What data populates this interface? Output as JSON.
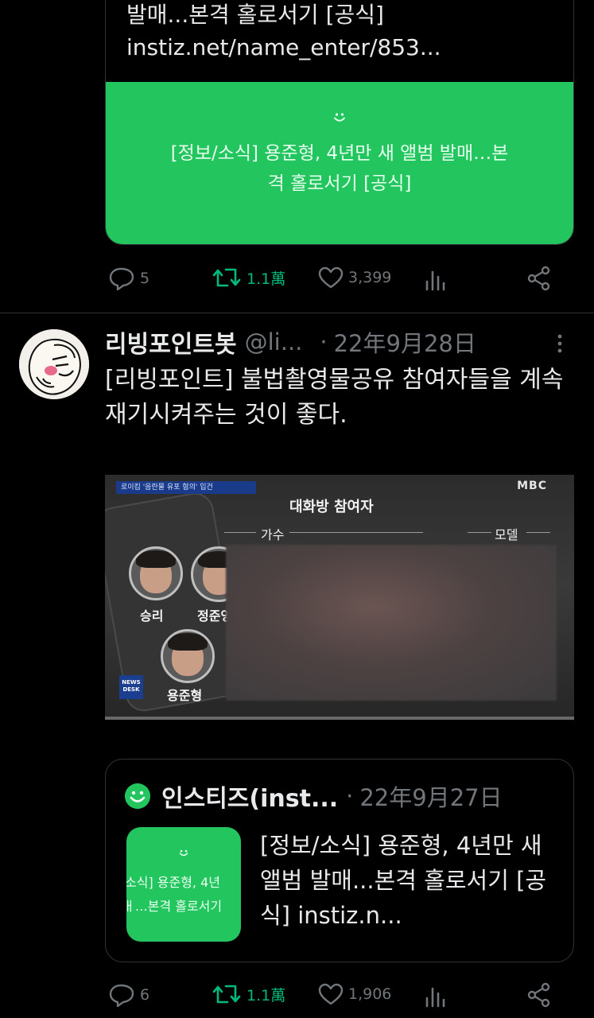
{
  "tweet1": {
    "card_title_line1": "발매...본격 홀로서기 [공식]",
    "card_url": "instiz.net/name_enter/853...",
    "card_image_text": "[정보/소식] 용준형, 4년만 새 앨범 발매…본격 홀로서기 [공식]",
    "replies": "5",
    "retweets": "1.1萬",
    "likes": "3,399"
  },
  "tweet2": {
    "display_name": "리빙포인트봇",
    "handle": "@li...",
    "dot": "·",
    "date": "22年9月28日",
    "text": "[리빙포인트] 불법촬영물공유 참여자들을 계속 재기시켜주는 것이 좋다.",
    "media": {
      "top_caption": "로이킴 '음란물 유포 혐의' 입건",
      "network": "MBC",
      "title": "대화방 참여자",
      "label_singer": "가수",
      "label_model": "모델",
      "names": [
        "승리",
        "정준영",
        "용준형"
      ],
      "news_badge": "NEWS DESK"
    },
    "quote": {
      "name": "인스티즈(inst...",
      "dot": "·",
      "date": "22年9月27日",
      "thumb_line1": "소식] 용준형, 4년",
      "thumb_line2": "ㅐ…본격 홀로서기",
      "text": "[정보/소식] 용준형, 4년만 새 앨범 발매...본격 홀로서기 [공식] instiz.n..."
    },
    "replies": "6",
    "retweets": "1.1萬",
    "likes": "1,906"
  },
  "colors": {
    "accent_green": "#22c55e",
    "retweet_green": "#00ba7c",
    "muted": "#71767b"
  },
  "icons": [
    "reply-icon",
    "retweet-icon",
    "like-icon",
    "views-icon",
    "share-icon",
    "more-icon",
    "instiz-smile-icon"
  ]
}
